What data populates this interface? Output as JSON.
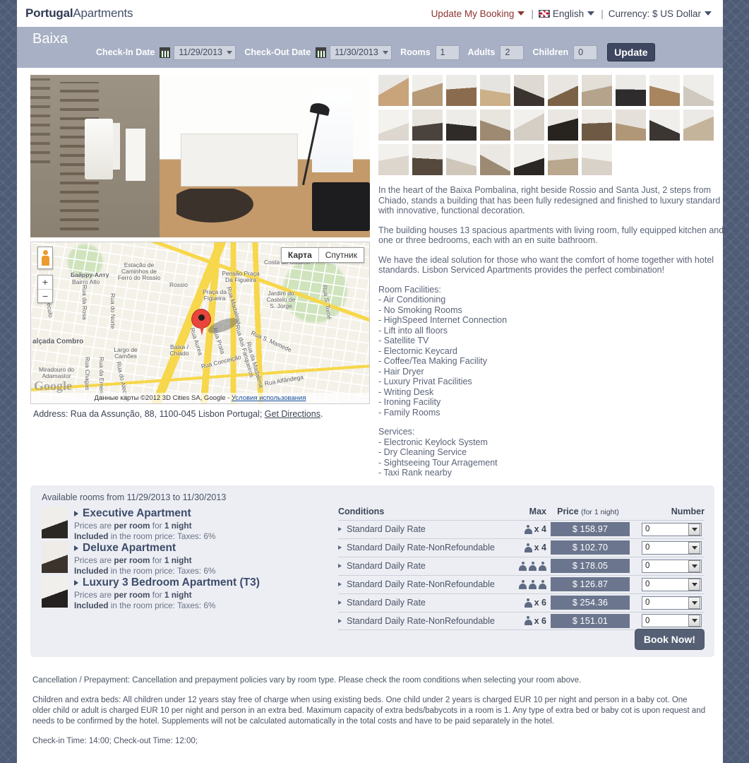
{
  "header": {
    "logo_bold": "Portugal",
    "logo_light": "Apartments",
    "update_booking": "Update My Booking",
    "language": "English",
    "currency": "Currency: $ US Dollar",
    "sep": "|"
  },
  "booking_bar": {
    "city": "Baixa",
    "checkin_label": "Check-In Date",
    "checkin_value": "11/29/2013",
    "checkout_label": "Check-Out Date",
    "checkout_value": "11/30/2013",
    "rooms_label": "Rooms",
    "rooms_value": "1",
    "adults_label": "Adults",
    "adults_value": "2",
    "children_label": "Children",
    "children_value": "0",
    "update_button": "Update"
  },
  "map": {
    "type_map": "Карта",
    "type_satellite": "Спутник",
    "zoom_in": "+",
    "zoom_out": "−",
    "attribution": "Данные карты ©2012 3D Cities SA, Google - ",
    "attribution_link": "Условия использования",
    "google_logo": "Google",
    "address_prefix": "Address: Rua da Assunção, 88, 1100-045 Lisbon Portugal; ",
    "address_link": "Get Directions",
    "address_suffix": ".",
    "labels": [
      "Байрру-Алту",
      "Bairro Alto",
      "Estação de Caminhos de Ferro do Rossio",
      "Rossio",
      "Pensão Praça Da Figueira",
      "Costa do Castelo",
      "Praça da Figueira",
      "Jardim do Castelo de S. Jorge",
      "Baixa / Chiado",
      "Largo de Camões",
      "Miradouro do Adamastor",
      "alçada Combro",
      "Rua da Rosa",
      "Rua do Norte",
      "Rua Chagas",
      "Rua da Emenda",
      "Rua Aurea",
      "Rua Prata",
      "Rua Madalena",
      "Rua dos Fanqueiros",
      "Rua da Madalena",
      "Rua S. Mamede",
      "Rua S. Tomé",
      "Rua Conceição",
      "Rua Alfândega",
      "Rua Século",
      "Rua do Alecrim"
    ]
  },
  "description": {
    "paragraphs": [
      "In the heart of the Baixa Pombalina, right beside Rossio and Santa Just, 2 steps from Chiado, stands a building that has been fully redesigned and finished to luxury standard with innovative, functional decoration.",
      "The building houses 13 spacious apartments with living room, fully equipped kitchen and one or three bedrooms, each with an en suite bathroom.",
      "We have the ideal solution for those who want the comfort of home together with hotel standards. Lisbon Serviced Apartments provides the perfect combination!"
    ],
    "facilities_title": "Room Facilities:",
    "facilities": [
      "- Air Conditioning",
      "- No Smoking Rooms",
      "- HighSpeed Internet Connection",
      "- Lift into all floors",
      "- Satellite TV",
      "- Electornic Keycard",
      "- Coffee/Tea Making Facility",
      "- Hair Dryer",
      "- Luxury Privat Facilities",
      "- Writing Desk",
      "- Ironing Facility",
      "- Family Rooms"
    ],
    "services_title": "Services:",
    "services": [
      "- Electronic Keylock System",
      "- Dry Cleaning Service",
      "- Sightseeing Tour Arragement",
      "- Taxi Rank nearby"
    ]
  },
  "gallery": {
    "thumbnail_count": 27
  },
  "rooms_panel": {
    "available_text": "Available rooms from 11/29/2013 to 11/30/2013",
    "rooms": [
      {
        "name": "Executive Apartment",
        "price_note_pre": "Prices are ",
        "price_note_b1": "per room",
        "price_note_mid": " for ",
        "price_note_b2": "1 night",
        "tax_b": "Included",
        "tax_rest": " in the room price: Taxes: 6%"
      },
      {
        "name": "Deluxe Apartment",
        "price_note_pre": "Prices are ",
        "price_note_b1": "per room",
        "price_note_mid": " for ",
        "price_note_b2": "1 night",
        "tax_b": "Included",
        "tax_rest": " in the room price: Taxes: 6%"
      },
      {
        "name": "Luxury 3 Bedroom Apartment (T3)",
        "price_note_pre": "Prices are ",
        "price_note_b1": "per room",
        "price_note_mid": " for ",
        "price_note_b2": "1 night",
        "tax_b": "Included",
        "tax_rest": " in the room price: Taxes: 6%"
      }
    ],
    "table_headers": {
      "conditions": "Conditions",
      "max": "Max",
      "price": "Price ",
      "price_small": "(for 1 night)",
      "number": "Number"
    },
    "rates": [
      {
        "condition": "Standard Daily Rate",
        "max_icons": 1,
        "max_text": "x 4",
        "price": "$ 158.97",
        "number": "0"
      },
      {
        "condition": "Standard Daily Rate-NonRefoundable",
        "max_icons": 1,
        "max_text": "x 4",
        "price": "$ 102.70",
        "number": "0"
      },
      {
        "condition": "Standard Daily Rate",
        "max_icons": 3,
        "max_text": "",
        "price": "$ 178.05",
        "number": "0"
      },
      {
        "condition": "Standard Daily Rate-NonRefoundable",
        "max_icons": 3,
        "max_text": "",
        "price": "$ 126.87",
        "number": "0"
      },
      {
        "condition": "Standard Daily Rate",
        "max_icons": 1,
        "max_text": "x 6",
        "price": "$ 254.36",
        "number": "0"
      },
      {
        "condition": "Standard Daily Rate-NonRefoundable",
        "max_icons": 1,
        "max_text": "x 6",
        "price": "$ 151.01",
        "number": "0"
      }
    ],
    "book_now": "Book Now!"
  },
  "notes": {
    "cancellation": "Cancellation / Prepayment: Cancellation and prepayment policies vary by room type. Please check the room conditions when selecting your room above.",
    "children": "Children and extra beds: All children under 12 years stay free of charge when using existing beds. One child under 2 years is charged EUR 10 per night and person in a baby cot. One older child or adult is charged EUR 10 per night and person in an extra bed. Maximum capacity of extra beds/babycots in a room is 1. Any type of extra bed or baby cot is upon request and needs to be confirmed by the hotel. Supplements will not be calculated automatically in the total costs and have to be paid separately in the hotel.",
    "times": "Check-in Time: 14:00; Check-out Time: 12:00;"
  },
  "colors": {
    "accent_red": "#8d3431",
    "bar_bg": "#a7b0c4",
    "panel_bg": "#eceef3",
    "price_chip": "#6b768e",
    "button_dark": "#3e4760",
    "text_blue": "#3d4c6b"
  }
}
